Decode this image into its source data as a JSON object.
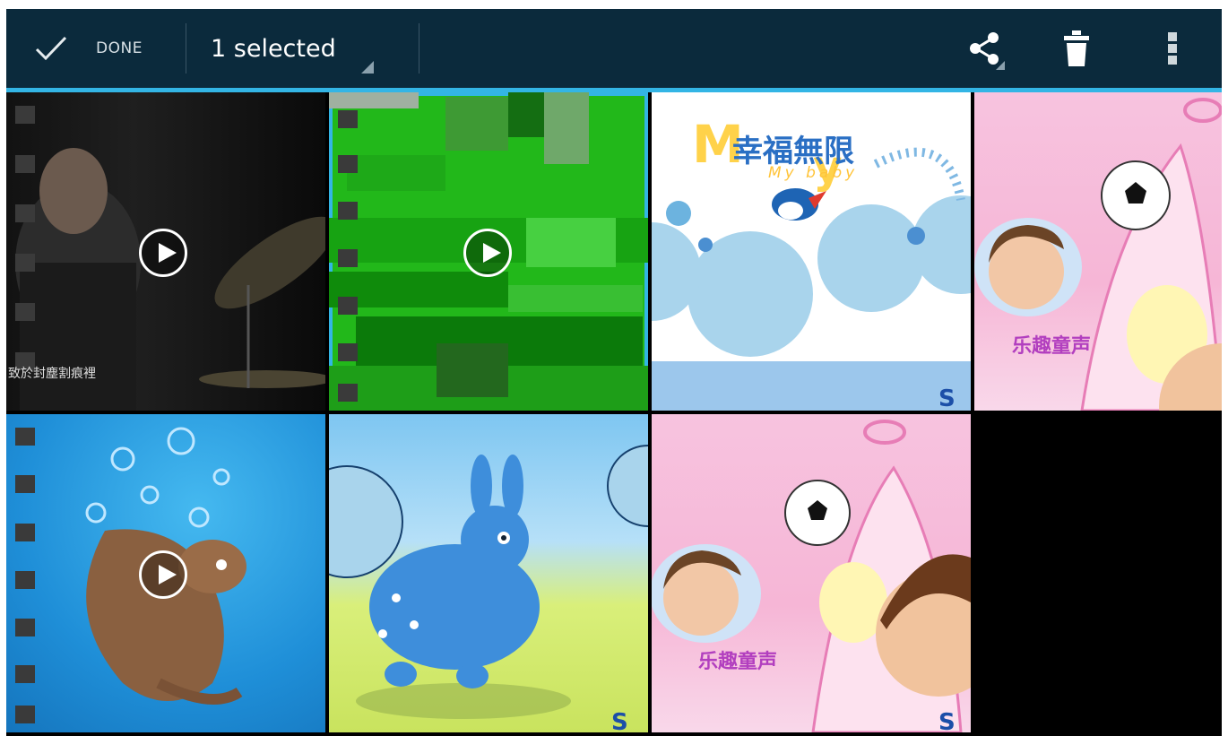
{
  "action_bar": {
    "done_label": "DONE",
    "selection_title": "1 selected",
    "accent_color": "#33b5e5",
    "background_color": "#0b2a3c",
    "actions": [
      "share-icon",
      "delete-icon",
      "overflow-menu-icon"
    ]
  },
  "grid": {
    "items": [
      {
        "name": "video-drummer",
        "type": "video",
        "selected": false,
        "caption": "致於封塵割痕裡"
      },
      {
        "name": "video-green-glitch",
        "type": "video",
        "selected": true
      },
      {
        "name": "image-my-baby",
        "type": "image",
        "selected": false,
        "title": "幸福無限",
        "subtitle": "My baby"
      },
      {
        "name": "image-pink-children",
        "type": "image",
        "selected": false,
        "caption": "乐趣童声"
      },
      {
        "name": "video-ice-age-squirrel",
        "type": "video",
        "selected": false
      },
      {
        "name": "image-blue-horse",
        "type": "image",
        "selected": false
      },
      {
        "name": "image-pink-children-2",
        "type": "image",
        "selected": false,
        "caption": "乐趣童声"
      }
    ]
  }
}
